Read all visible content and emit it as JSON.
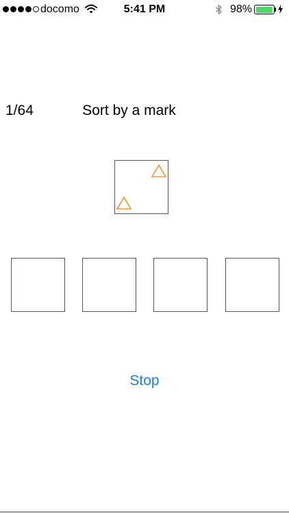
{
  "status_bar": {
    "carrier": "docomo",
    "time": "5:41 PM",
    "battery_percent": "98%",
    "battery_level": 0.98,
    "signal_bars_filled": 4,
    "signal_bars_total": 5,
    "battery_color": "#4cd964"
  },
  "game": {
    "progress": "1/64",
    "title": "Sort by a mark",
    "card": {
      "mark": "triangle",
      "mark_count": 2,
      "mark_color": "#f0952a"
    },
    "slots": [
      {
        "id": "slot-1"
      },
      {
        "id": "slot-2"
      },
      {
        "id": "slot-3"
      },
      {
        "id": "slot-4"
      }
    ],
    "stop_label": "Stop",
    "accent_color": "#1a7ee0"
  }
}
